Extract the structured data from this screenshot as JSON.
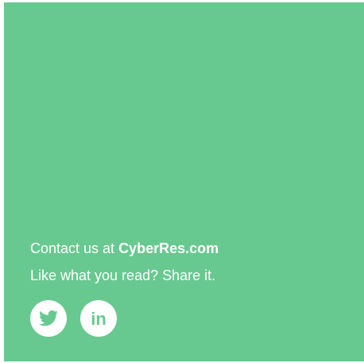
{
  "contact": {
    "prefix": "Contact us at ",
    "link_text": "CyberRes.com"
  },
  "share": {
    "text": "Like what you read? Share it."
  },
  "social": {
    "icons": [
      "twitter-icon",
      "linkedin-icon"
    ],
    "linkedin_glyph": "in"
  },
  "colors": {
    "background": "#67c98f",
    "text": "#ffffff",
    "icon_fill": "#ffffff",
    "icon_glyph": "#67c98f"
  }
}
